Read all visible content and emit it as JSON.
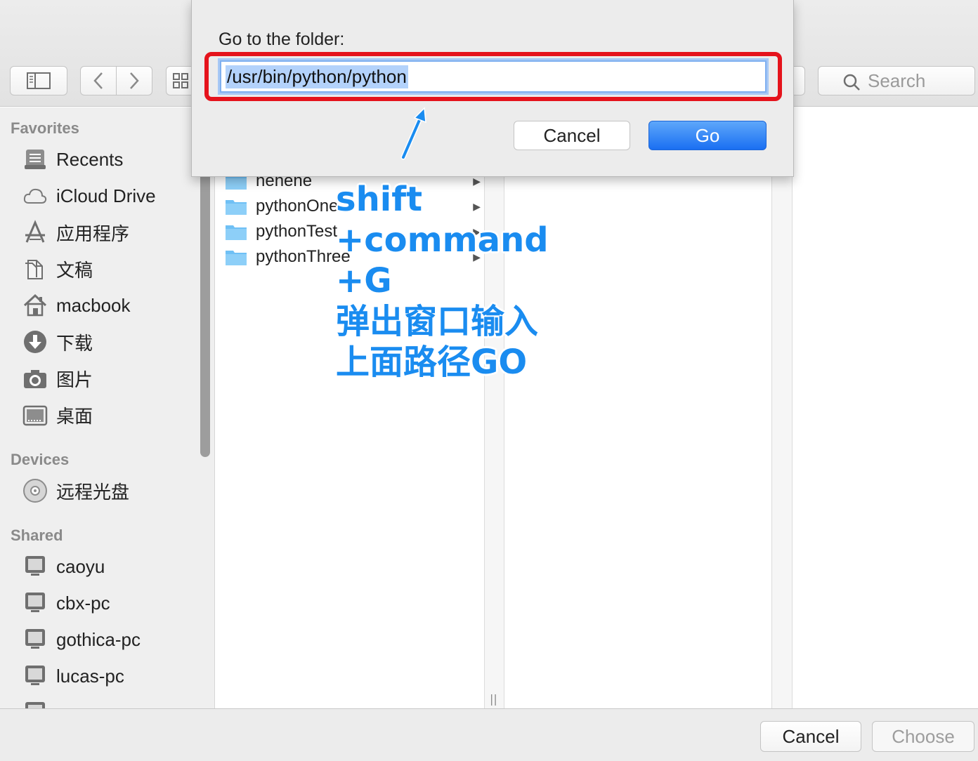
{
  "toolbar": {
    "search_placeholder": "Search",
    "back_glyph": "‹",
    "forward_glyph": "›"
  },
  "sidebar": {
    "favorites_header": "Favorites",
    "favorites": [
      {
        "label": "Recents",
        "icon": "recents-icon"
      },
      {
        "label": "iCloud Drive",
        "icon": "cloud-icon"
      },
      {
        "label": "应用程序",
        "icon": "applications-icon"
      },
      {
        "label": "文稿",
        "icon": "documents-icon"
      },
      {
        "label": "macbook",
        "icon": "home-icon"
      },
      {
        "label": "下载",
        "icon": "downloads-icon"
      },
      {
        "label": "图片",
        "icon": "camera-icon"
      },
      {
        "label": "桌面",
        "icon": "desktop-icon"
      }
    ],
    "devices_header": "Devices",
    "devices": [
      {
        "label": "远程光盘",
        "icon": "disc-icon"
      }
    ],
    "shared_header": "Shared",
    "shared": [
      {
        "label": "caoyu",
        "icon": "computer-icon"
      },
      {
        "label": "cbx-pc",
        "icon": "computer-icon"
      },
      {
        "label": "gothica-pc",
        "icon": "computer-icon"
      },
      {
        "label": "lucas-pc",
        "icon": "computer-icon"
      }
    ]
  },
  "browser": {
    "column1": [
      {
        "name": "hehehe"
      },
      {
        "name": "pythonOne"
      },
      {
        "name": "pythonTest"
      },
      {
        "name": "pythonThree"
      }
    ]
  },
  "goto_sheet": {
    "title": "Go to the folder:",
    "path_value": "/usr/bin/python/python",
    "cancel_label": "Cancel",
    "go_label": "Go"
  },
  "bottom": {
    "cancel_label": "Cancel",
    "choose_label": "Choose"
  },
  "annotation": {
    "lines": [
      "shift",
      "+command",
      "+G",
      "弹出窗口输入",
      "上面路径GO"
    ],
    "color": "#1a8cf0"
  },
  "colors": {
    "highlight_box": "#e5131c",
    "go_button": "#1a6ff2",
    "folder": "#6fc0f5"
  }
}
